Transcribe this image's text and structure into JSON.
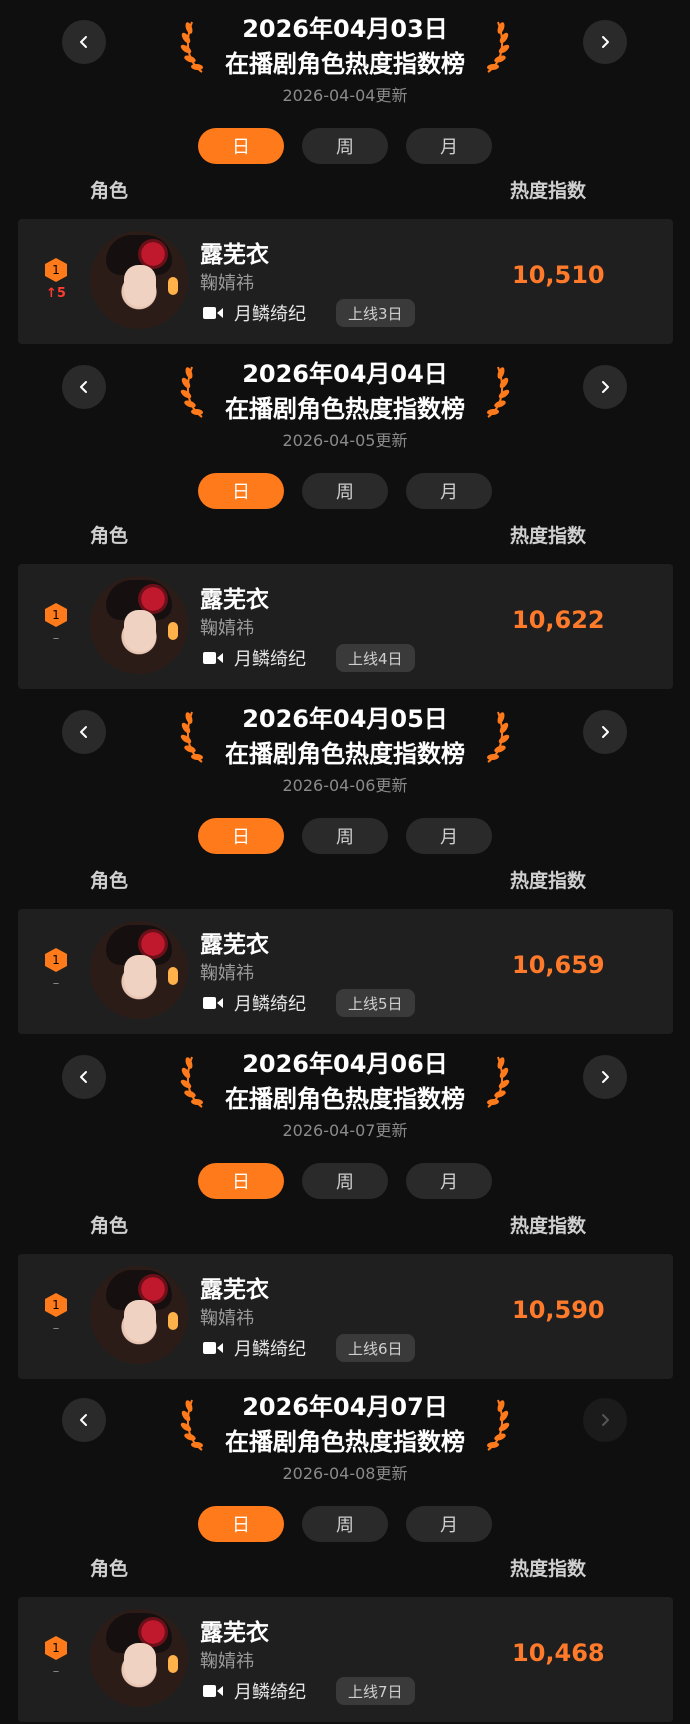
{
  "labels": {
    "tab_day": "日",
    "tab_week": "周",
    "tab_month": "月",
    "col_role": "角色",
    "col_heat": "热度指数",
    "list_title": "在播剧角色热度指数榜"
  },
  "sections": [
    {
      "date": "2026年04月03日",
      "updated": "2026-04-04更新",
      "entry": {
        "rank": "1",
        "change": "↑5",
        "name": "露芜衣",
        "actor": "鞠婧祎",
        "drama": "月鳞绮纪",
        "online": "上线3日",
        "score": "10,510"
      }
    },
    {
      "date": "2026年04月04日",
      "updated": "2026-04-05更新",
      "entry": {
        "rank": "1",
        "change": "–",
        "name": "露芜衣",
        "actor": "鞠婧祎",
        "drama": "月鳞绮纪",
        "online": "上线4日",
        "score": "10,622"
      }
    },
    {
      "date": "2026年04月05日",
      "updated": "2026-04-06更新",
      "entry": {
        "rank": "1",
        "change": "–",
        "name": "露芜衣",
        "actor": "鞠婧祎",
        "drama": "月鳞绮纪",
        "online": "上线5日",
        "score": "10,659"
      }
    },
    {
      "date": "2026年04月06日",
      "updated": "2026-04-07更新",
      "entry": {
        "rank": "1",
        "change": "–",
        "name": "露芜衣",
        "actor": "鞠婧祎",
        "drama": "月鳞绮纪",
        "online": "上线6日",
        "score": "10,590"
      }
    },
    {
      "date": "2026年04月07日",
      "updated": "2026-04-08更新",
      "entry": {
        "rank": "1",
        "change": "–",
        "name": "露芜衣",
        "actor": "鞠婧祎",
        "drama": "月鳞绮纪",
        "online": "上线7日",
        "score": "10,468"
      }
    }
  ],
  "icons": {
    "prev": "chevron-left-icon",
    "next": "chevron-right-icon",
    "laurel": "laurel-icon",
    "rank": "hexagon-rank-icon",
    "drama": "video-camera-icon"
  },
  "colors": {
    "accent": "#ff7a1a",
    "score": "#ff7a2a",
    "up": "#ff3b30",
    "background": "#0f0f0f",
    "card": "#1f1f1f"
  }
}
